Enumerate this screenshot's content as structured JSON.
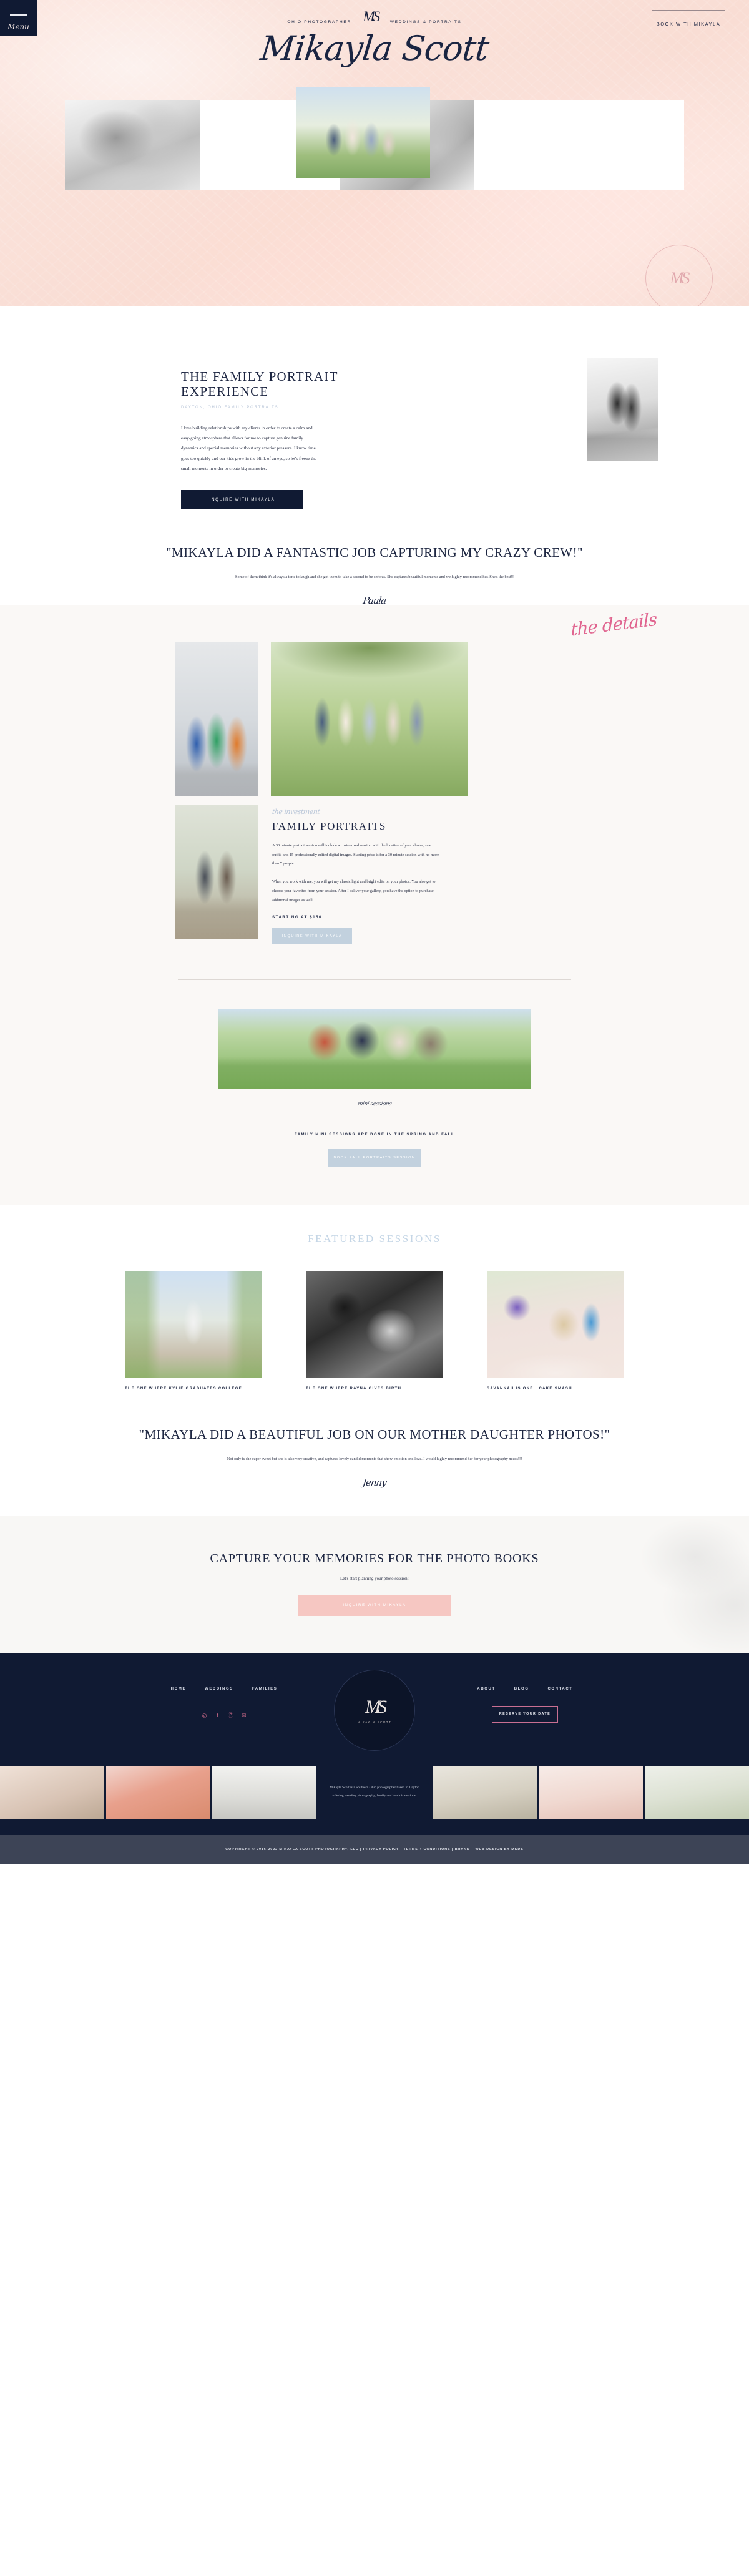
{
  "header": {
    "menu_label": "Menu",
    "tagline_left": "OHIO PHOTOGRAPHER",
    "tagline_right": "WEDDINGS & PORTRAITS",
    "monogram": "MS",
    "brand_name": "Mikayla Scott",
    "book_button": "BOOK WITH MIKAYLA",
    "watermark": "MS"
  },
  "experience": {
    "heading": "THE FAMILY PORTRAIT EXPERIENCE",
    "eyebrow": "DAYTON, OHIO FAMILY PORTRAITS",
    "body": "I love building relationships with my clients in order to create a calm and easy-going atmosphere that allows for me to capture genuine family dynamics and special memories without any exterior pressure. I know time goes too quickly and our kids grow in the blink of an eye, so let's freeze the small moments in order to create big memories.",
    "cta": "INQUIRE WITH MIKAYLA"
  },
  "testimonial_1": {
    "quote": "\"MIKAYLA DID A FANTASTIC JOB CAPTURING MY CRAZY CREW!\"",
    "body": "Some of them think it's always a time to laugh and she got them to take a second to be serious. She captures beautiful moments and we highly recommend her. She's the best!!",
    "signature": "Paula"
  },
  "details": {
    "script_heading": "the details",
    "investment_script": "the investment",
    "investment_heading": "FAMILY PORTRAITS",
    "paragraph_1": "A 30 minute portrait session will include a customized session with the location of your choice, one outfit, and 15 professionally edited digital images. Starting price is for a 30 minute session with no more than 7 people.",
    "paragraph_2": "When you work with me, you will get my classic light and bright edits on your photos. You also get to choose your favorites from your session. After I deliver your gallery, you have the option to purchase additional images as well.",
    "price": "STARTING AT $150",
    "cta": "INQUIRE WITH MIKAYLA"
  },
  "mini_sessions": {
    "script_heading": "mini sessions",
    "note": "FAMILY MINI SESSIONS ARE DONE IN THE SPRING AND FALL",
    "cta": "BOOK FALL PORTRAITS SESSION"
  },
  "featured": {
    "heading": "FEATURED SESSIONS",
    "cards": [
      {
        "caption": "THE ONE WHERE KYLIE GRADUATES COLLEGE"
      },
      {
        "caption": "THE ONE WHERE RAYNA GIVES BIRTH"
      },
      {
        "caption": "SAVANNAH IS ONE | CAKE SMASH"
      }
    ]
  },
  "testimonial_2": {
    "quote": "\"MIKAYLA DID A BEAUTIFUL JOB ON OUR MOTHER DAUGHTER PHOTOS!\"",
    "body": "Not only is she super sweet but she is also very creative, and captures lovely candid moments that show emotion and love. I would highly recommend her for your photography needs!!!",
    "signature": "Jenny"
  },
  "cta": {
    "heading": "CAPTURE YOUR MEMORIES FOR THE PHOTO BOOKS",
    "subheading": "Let's start planning your photo session!",
    "button": "INQUIRE WITH MIKAYLA"
  },
  "footer": {
    "nav_left": [
      "HOME",
      "WEDDINGS",
      "FAMILIES"
    ],
    "nav_right": [
      "ABOUT",
      "BLOG",
      "CONTACT"
    ],
    "social": [
      "instagram-icon",
      "facebook-icon",
      "pinterest-icon",
      "email-icon"
    ],
    "social_glyphs": [
      "◎",
      "f",
      "Ⓟ",
      "✉"
    ],
    "crest_monogram": "MS",
    "crest_name": "MIKAYLA SCOTT",
    "reserve_button": "RESERVE YOUR DATE",
    "bio": "Mikayla Scott is a Southern Ohio photographer based in Dayton offering wedding photography, family and boudoir sessions.",
    "copyright": "COPYRIGHT © 2016-2022 MIKAYLA SCOTT PHOTOGRAPHY, LLC | PRIVACY POLICY | TERMS + CONDITIONS | BRAND + WEB DESIGN BY MKDS"
  },
  "colors": {
    "navy": "#101a33",
    "blush": "#f6c7c2",
    "pink_script": "#e0648f",
    "blue_button": "#c2d1de",
    "light_blue_text": "#c5d6e6"
  }
}
